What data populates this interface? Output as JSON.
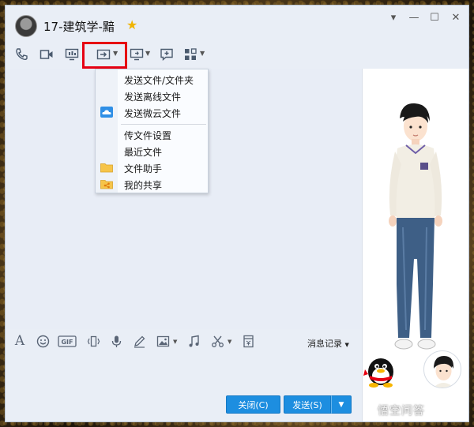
{
  "window": {
    "title": "17-建筑学-黯",
    "controls": [
      "▾",
      "—",
      "☐",
      "✕"
    ]
  },
  "toolbar": {
    "icons": [
      "phone-icon",
      "video-icon",
      "screen-share-icon",
      "file-transfer-icon",
      "remote-desktop-icon",
      "feedback-icon",
      "apps-icon"
    ]
  },
  "file_menu": {
    "items": [
      {
        "label": "发送文件/文件夹",
        "icon": ""
      },
      {
        "label": "发送离线文件",
        "icon": ""
      },
      {
        "label": "发送微云文件",
        "icon": "weiyun-cloud-icon"
      },
      {
        "label": "传文件设置",
        "icon": ""
      },
      {
        "label": "最近文件",
        "icon": ""
      },
      {
        "label": "文件助手",
        "icon": "folder-icon"
      },
      {
        "label": "我的共享",
        "icon": "shared-folder-icon"
      }
    ]
  },
  "input_toolbar": {
    "icons": [
      "font-icon",
      "emoji-icon",
      "gif-icon",
      "vibrate-icon",
      "voice-icon",
      "handwrite-icon",
      "image-icon",
      "music-icon",
      "screenshot-scissors-icon",
      "red-packet-icon"
    ],
    "history_label": "消息记录"
  },
  "buttons": {
    "close_label": "关闭(C)",
    "send_label": "发送(S)"
  },
  "watermark": "悟空问答",
  "colors": {
    "highlight": "#e60012",
    "button_blue": "#1d8ee0",
    "window_bg": "#e9eef6",
    "star": "#f0b400"
  }
}
